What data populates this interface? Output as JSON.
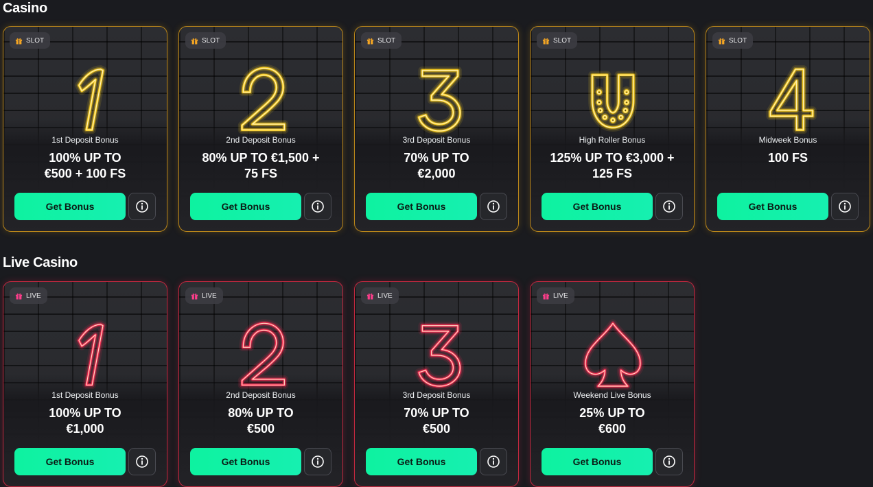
{
  "sections": [
    {
      "title": "Casino",
      "badge": "SLOT",
      "cards": [
        {
          "icon": "neon-one-icon",
          "subtitle": "1st Deposit Bonus",
          "line1": "100% UP TO",
          "line2": "€500 + 100 FS",
          "button": "Get Bonus"
        },
        {
          "icon": "neon-two-icon",
          "subtitle": "2nd Deposit Bonus",
          "line1": "80% UP TO €1,500 +",
          "line2": "75 FS",
          "button": "Get Bonus"
        },
        {
          "icon": "neon-three-icon",
          "subtitle": "3rd Deposit Bonus",
          "line1": "70% UP TO",
          "line2": "€2,000",
          "button": "Get Bonus"
        },
        {
          "icon": "neon-horseshoe-icon",
          "subtitle": "High Roller Bonus",
          "line1": "125% UP TO €3,000 +",
          "line2": "125 FS",
          "button": "Get Bonus"
        },
        {
          "icon": "neon-four-icon",
          "subtitle": "Midweek Bonus",
          "line1": "100 FS",
          "line2": "",
          "button": "Get Bonus"
        }
      ]
    },
    {
      "title": "Live Casino",
      "badge": "LIVE",
      "cards": [
        {
          "icon": "neon-one-icon",
          "subtitle": "1st Deposit Bonus",
          "line1": "100% UP TO",
          "line2": "€1,000",
          "button": "Get Bonus"
        },
        {
          "icon": "neon-two-icon",
          "subtitle": "2nd Deposit Bonus",
          "line1": "80% UP TO",
          "line2": "€500",
          "button": "Get Bonus"
        },
        {
          "icon": "neon-three-icon",
          "subtitle": "3rd Deposit Bonus",
          "line1": "70% UP TO",
          "line2": "€500",
          "button": "Get Bonus"
        },
        {
          "icon": "neon-spade-icon",
          "subtitle": "Weekend Live Bonus",
          "line1": "25% UP TO",
          "line2": "€600",
          "button": "Get Bonus"
        }
      ]
    }
  ],
  "colors": {
    "slot_neon": "#ffd21e",
    "slot_border": "#b9851a",
    "live_neon": "#ff2d55",
    "live_border": "#c2283f",
    "button": "#0ef2a0",
    "badge_gift_slot": "#f5a623",
    "badge_gift_live": "#ff3d8b"
  }
}
